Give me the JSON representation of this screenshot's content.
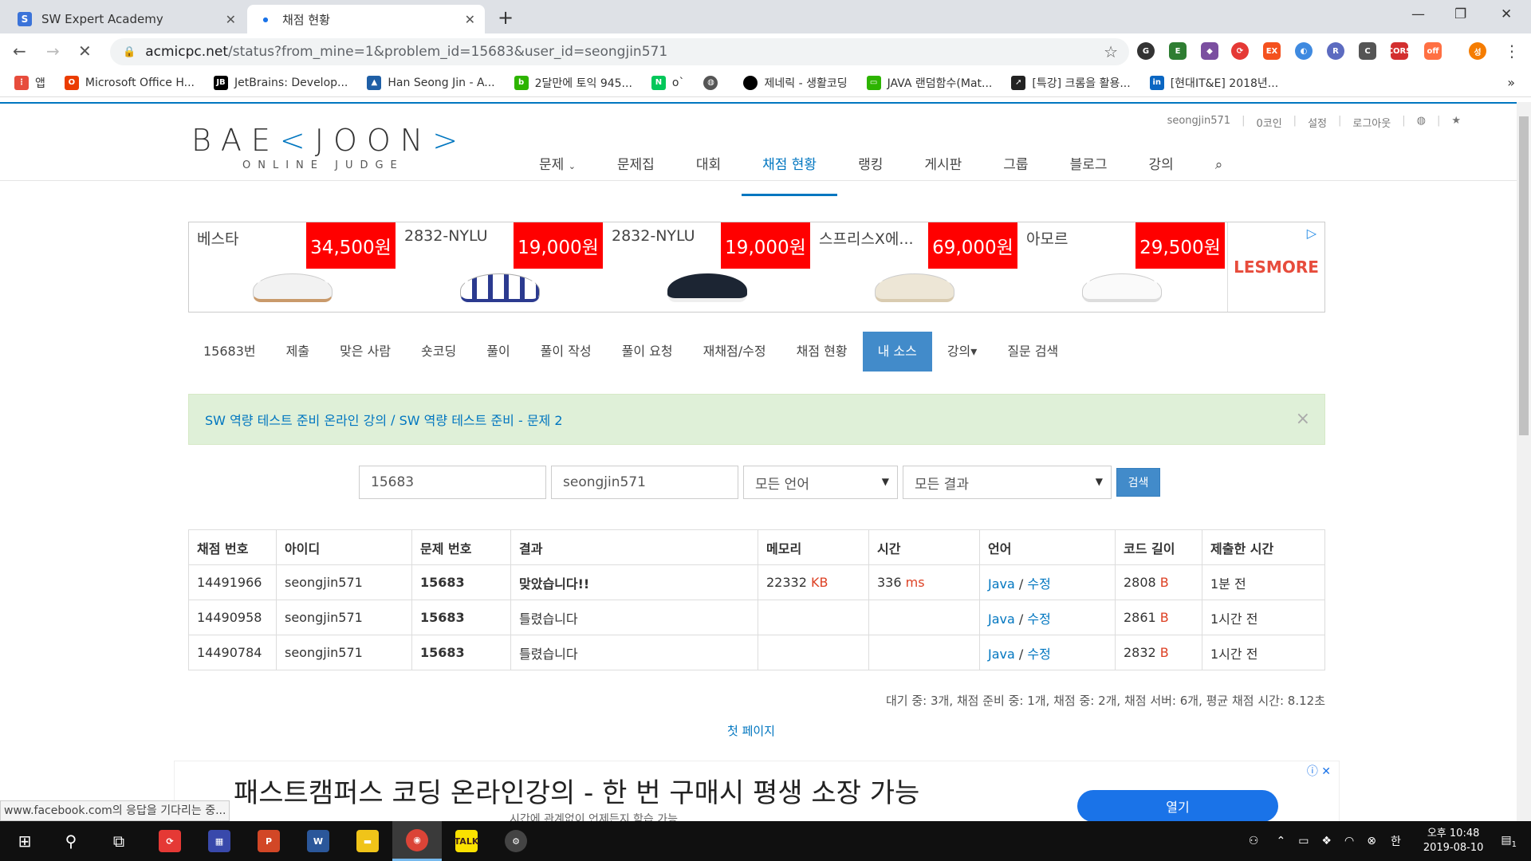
{
  "browser": {
    "tabs": [
      {
        "title": "SW Expert Academy",
        "favicon": "S"
      },
      {
        "title": "채점 현황",
        "favicon": ""
      }
    ],
    "url_host": "acmicpc.net",
    "url_path": "/status?from_mine=1&problem_id=15683&user_id=seongjin571",
    "bookmarks": [
      {
        "label": "앱",
        "icon": "apps-icon",
        "color": "#e74c3c"
      },
      {
        "label": "Microsoft Office H...",
        "icon": "office-icon",
        "color": "#eb3c00"
      },
      {
        "label": "JetBrains: Develop...",
        "icon": "jetbrains-icon",
        "color": "#000000"
      },
      {
        "label": "Han Seong Jin - A...",
        "icon": "han-icon",
        "color": "#1f5fa6"
      },
      {
        "label": "2달만에 토익 945...",
        "icon": "blog-icon",
        "color": "#2db400"
      },
      {
        "label": "o`",
        "icon": "naver-icon",
        "color": "#03c75a"
      },
      {
        "label": "",
        "icon": "globe-icon",
        "color": "#555555"
      },
      {
        "label": "제네릭 - 생활코딩",
        "icon": "circle-icon",
        "color": "#000000"
      },
      {
        "label": "JAVA 랜덤함수(Mat...",
        "icon": "chat-icon",
        "color": "#2db400"
      },
      {
        "label": "[특강] 크롬을 활용...",
        "icon": "arrow-icon",
        "color": "#222222"
      },
      {
        "label": "[현대IT&E] 2018년...",
        "icon": "linkedin-icon",
        "color": "#0a66c2"
      }
    ],
    "more_bookmarks": "»"
  },
  "site": {
    "logo_main": "BAE",
    "logo_mid": "JOON",
    "logo_sub": "ONLINE JUDGE",
    "toplinks": [
      "seongjin571",
      "0코인",
      "설정",
      "로그아웃"
    ],
    "nav": [
      "문제",
      "문제집",
      "대회",
      "채점 현황",
      "랭킹",
      "게시판",
      "그룹",
      "블로그",
      "강의"
    ],
    "nav_active_index": 3
  },
  "ad": {
    "products": [
      {
        "name": "베스타",
        "price": "34,500원"
      },
      {
        "name": "2832-NYLU",
        "price": "19,000원"
      },
      {
        "name": "2832-NYLU",
        "price": "19,000원"
      },
      {
        "name": "스프리스X에...",
        "price": "69,000원"
      },
      {
        "name": "아모르",
        "price": "29,500원"
      }
    ],
    "brand": "LESMORE"
  },
  "subnav": {
    "items": [
      "15683번",
      "제출",
      "맞은 사람",
      "숏코딩",
      "풀이",
      "풀이 작성",
      "풀이 요청",
      "재채점/수정",
      "채점 현황",
      "내 소스",
      "강의▾",
      "질문 검색"
    ],
    "active_index": 9
  },
  "alert": {
    "link1": "SW 역량 테스트 준비 온라인 강의",
    "sep": " / ",
    "link2": "SW 역량 테스트 준비 - 문제 2"
  },
  "search": {
    "problem": "15683",
    "user": "seongjin571",
    "language": "모든 언어",
    "result": "모든 결과",
    "button": "검색"
  },
  "table": {
    "headers": [
      "채점 번호",
      "아이디",
      "문제 번호",
      "결과",
      "메모리",
      "시간",
      "언어",
      "코드 길이",
      "제출한 시간"
    ],
    "rows": [
      {
        "id": "14491966",
        "user": "seongjin571",
        "problem": "15683",
        "result": "맞았습니다!!",
        "ok": true,
        "memory": "22332",
        "memory_unit": " KB",
        "time": "336",
        "time_unit": " ms",
        "lang": "Java",
        "edit": "수정",
        "length": "2808",
        "length_unit": " B",
        "submitted": "1분 전"
      },
      {
        "id": "14490958",
        "user": "seongjin571",
        "problem": "15683",
        "result": "틀렸습니다",
        "ok": false,
        "memory": "",
        "memory_unit": "",
        "time": "",
        "time_unit": "",
        "lang": "Java",
        "edit": "수정",
        "length": "2861",
        "length_unit": " B",
        "submitted": "1시간 전"
      },
      {
        "id": "14490784",
        "user": "seongjin571",
        "problem": "15683",
        "result": "틀렸습니다",
        "ok": false,
        "memory": "",
        "memory_unit": "",
        "time": "",
        "time_unit": "",
        "lang": "Java",
        "edit": "수정",
        "length": "2832",
        "length_unit": " B",
        "submitted": "1시간 전"
      }
    ]
  },
  "stats": "대기 중: 3개, 채점 준비 중: 1개, 채점 중: 2개, 채점 서버: 6개, 평균 채점 시간: 8.12초",
  "first_page": "첫 페이지",
  "bottom_ad": {
    "headline": "패스트캠퍼스 코딩 온라인강의 - 한 번 구매시 평생 소장 가능",
    "sub": "시간에 관계없이 언제든지 학습 가능",
    "button": "열기"
  },
  "status_message": "www.facebook.com의 응답을 기다리는 중...",
  "taskbar": {
    "clock_time": "오후 10:48",
    "clock_date": "2019-08-10",
    "ime": "한",
    "notif_count": "1"
  },
  "colors": {
    "accent": "#0076c0",
    "ok": "#009874",
    "wrong": "#dd4124",
    "ad_price": "#ff0000"
  }
}
